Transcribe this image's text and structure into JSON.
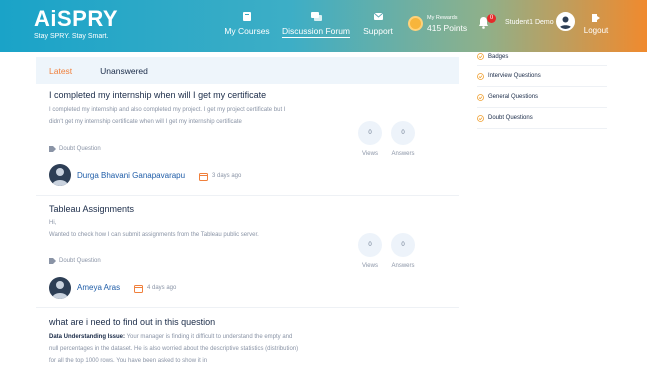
{
  "brand": {
    "logo": "AiSPRY",
    "tagline": "Stay SPRY. Stay Smart."
  },
  "nav": {
    "courses": "My Courses",
    "forum": "Discussion Forum",
    "support": "Support"
  },
  "rewards": {
    "label": "My Rewards",
    "value": "415 Points"
  },
  "notifications": {
    "count": "0"
  },
  "user": {
    "name": "Student1 Demo"
  },
  "logout": "Logout",
  "tabs": {
    "latest": "Latest",
    "unanswered": "Unanswered"
  },
  "colors": {
    "accent": "#f0803c",
    "link": "#1f5da8",
    "header_start": "#1aa3c8",
    "header_end": "#f08a2e"
  },
  "posts": [
    {
      "title": "I completed my internship when will I get my certificate",
      "body": "I completed my internship and also completed my project. I get my project certificate but I didn't get my internship certificate when will I get my internship certificate",
      "tag": "Doubt Question",
      "views": "0",
      "views_label": "Views",
      "answers": "0",
      "answers_label": "Answers",
      "author": "Durga Bhavani Ganapavarapu",
      "time": "3 days ago"
    },
    {
      "title": "Tableau Assignments",
      "body_line1": "Hi,",
      "body_line2": "Wanted to check how I  can submit assignments from the Tableau public server.",
      "tag": "Doubt Question",
      "views": "0",
      "views_label": "Views",
      "answers": "0",
      "answers_label": "Answers",
      "author": "Ameya Aras",
      "time": "4 days ago"
    },
    {
      "title": "what are i need to find out in this question",
      "body_bold": "Data Understanding Issue:",
      "body": " Your manager is finding it difficult to understand the empty and null percentages in the dataset.  He is also worried about the descriptive statistics (distribution) for all the top 1000 rows. You have been asked to show it in"
    }
  ],
  "sidebar": {
    "items": [
      {
        "label": "Badges"
      },
      {
        "label": "Interview Questions"
      },
      {
        "label": "General Questions"
      },
      {
        "label": "Doubt Questions"
      }
    ]
  }
}
